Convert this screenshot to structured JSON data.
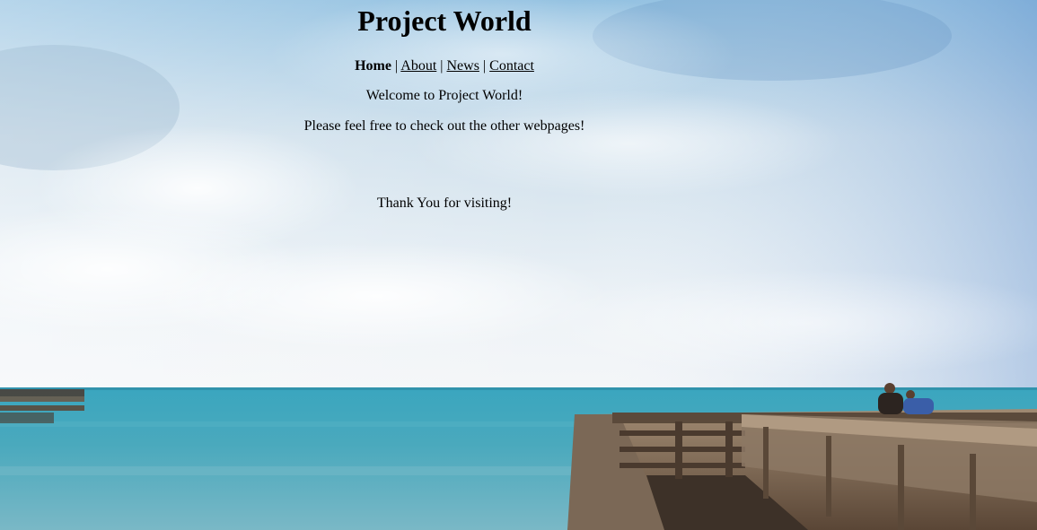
{
  "page": {
    "title": "Project World",
    "nav": {
      "home": "Home",
      "about": "About",
      "news": "News",
      "contact": "Contact",
      "separator": "|"
    },
    "welcome": "Welcome to Project World!",
    "invite": "Please feel free to check out the other webpages!",
    "thanks": "Thank You for visiting!"
  },
  "background": {
    "scene": "ocean-pier-photo",
    "colors": {
      "sky_top": "#7fb3d6",
      "sky_haze": "#eef3f6",
      "sea": "#3f9fb6",
      "pier_wood": "#6e5a45"
    }
  }
}
